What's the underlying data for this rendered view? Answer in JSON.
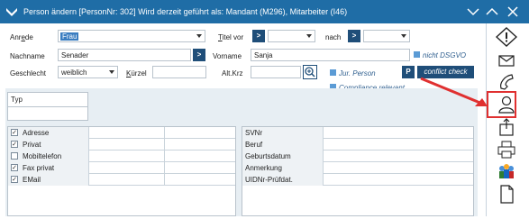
{
  "window": {
    "title": "Person ändern  [PersonNr: 302] Wird derzeit geführt als: Mandant (M296), Mitarbeiter (I46)"
  },
  "form": {
    "anrede_label": "Anrede",
    "anrede_value": "Frau",
    "titel_vor_label": "Titel vor",
    "titel_vor_btn": ">",
    "nach_label": "nach",
    "nach_btn": ">",
    "nachname_label": "Nachname",
    "nachname_value": "Senader",
    "nachname_btn": ">",
    "vorname_label": "Vorname",
    "vorname_value": "Sanja",
    "nicht_dsgvo": "nicht DSGVO",
    "geschlecht_label": "Geschlecht",
    "geschlecht_value": "weiblich",
    "kuerzel_label": "Kürzel",
    "altkrz_label": "Alt.Krz",
    "jur_person": "Jur. Person",
    "p_btn": "P",
    "conflict_btn": "conflict check",
    "compliance": "Compliance relevant"
  },
  "typ": {
    "header": "Typ"
  },
  "contacts_left": [
    {
      "label": "Adresse",
      "checked": true
    },
    {
      "label": "Privat",
      "checked": true
    },
    {
      "label": "Mobiltelefon",
      "checked": false
    },
    {
      "label": "Fax privat",
      "checked": true
    },
    {
      "label": "EMail",
      "checked": true
    }
  ],
  "contacts_right": [
    {
      "label": "SVNr"
    },
    {
      "label": "Beruf"
    },
    {
      "label": "Geburtsdatum"
    },
    {
      "label": "Anmerkung"
    },
    {
      "label": "UIDNr-Prüfdat."
    }
  ],
  "colors": {
    "titlebar": "#1f6da6",
    "button": "#1f4e79",
    "highlight": "#e03030"
  },
  "sidebar_icons": [
    "warning-icon",
    "mail-icon",
    "phone-icon",
    "person-icon",
    "export-icon",
    "print-icon",
    "people-icon",
    "document-icon"
  ]
}
